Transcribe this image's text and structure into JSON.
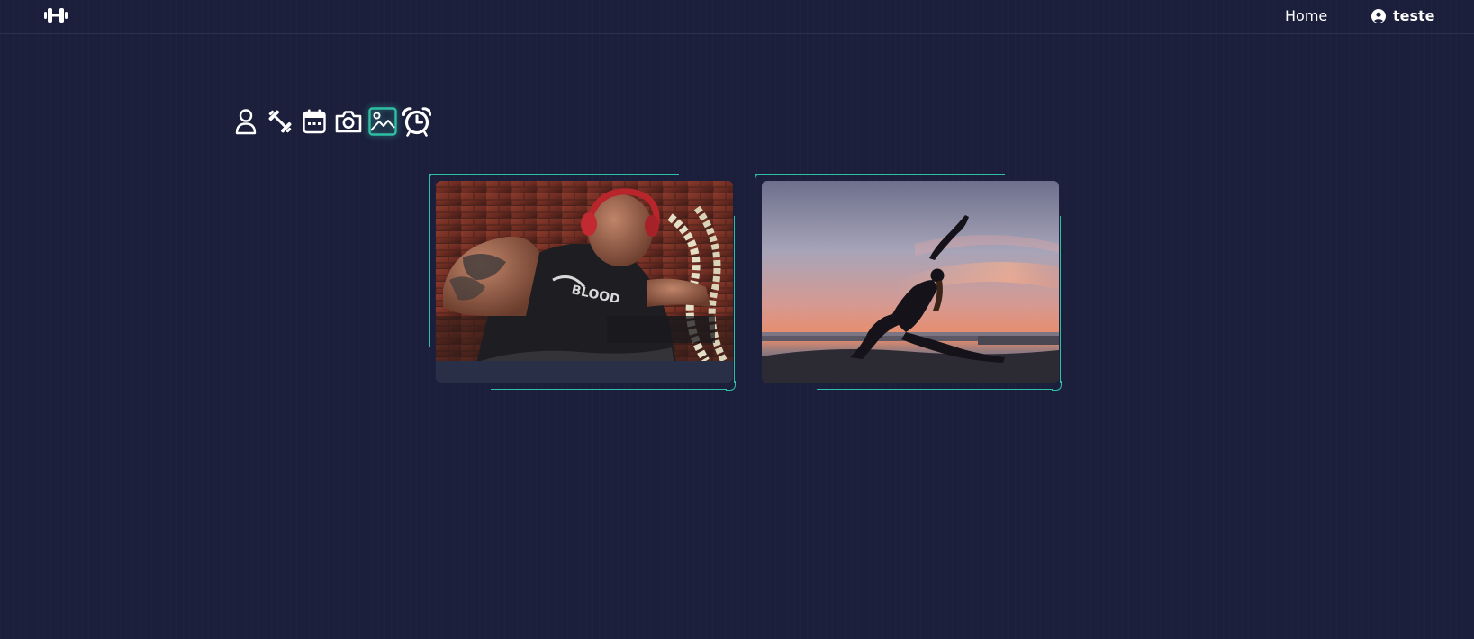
{
  "navbar": {
    "logo_icon": "dumbbell-icon",
    "home_label": "Home",
    "user_icon": "user-circle-icon",
    "user_name": "teste"
  },
  "toolbar": {
    "items": [
      {
        "icon": "person-icon",
        "active": false
      },
      {
        "icon": "dumbbell-diagonal-icon",
        "active": false
      },
      {
        "icon": "calendar-icon",
        "active": false
      },
      {
        "icon": "camera-icon",
        "active": false
      },
      {
        "icon": "image-icon",
        "active": true
      },
      {
        "icon": "alarm-clock-icon",
        "active": false
      }
    ],
    "active_color": "#2fbfa5"
  },
  "gallery": {
    "accent_color": "#2fbfa5",
    "items": [
      {
        "image": "man-training-with-rope-photo"
      },
      {
        "image": "woman-yoga-sunset-silhouette-photo"
      }
    ]
  },
  "colors": {
    "background": "#1b1f3b",
    "text": "#ffffff"
  }
}
